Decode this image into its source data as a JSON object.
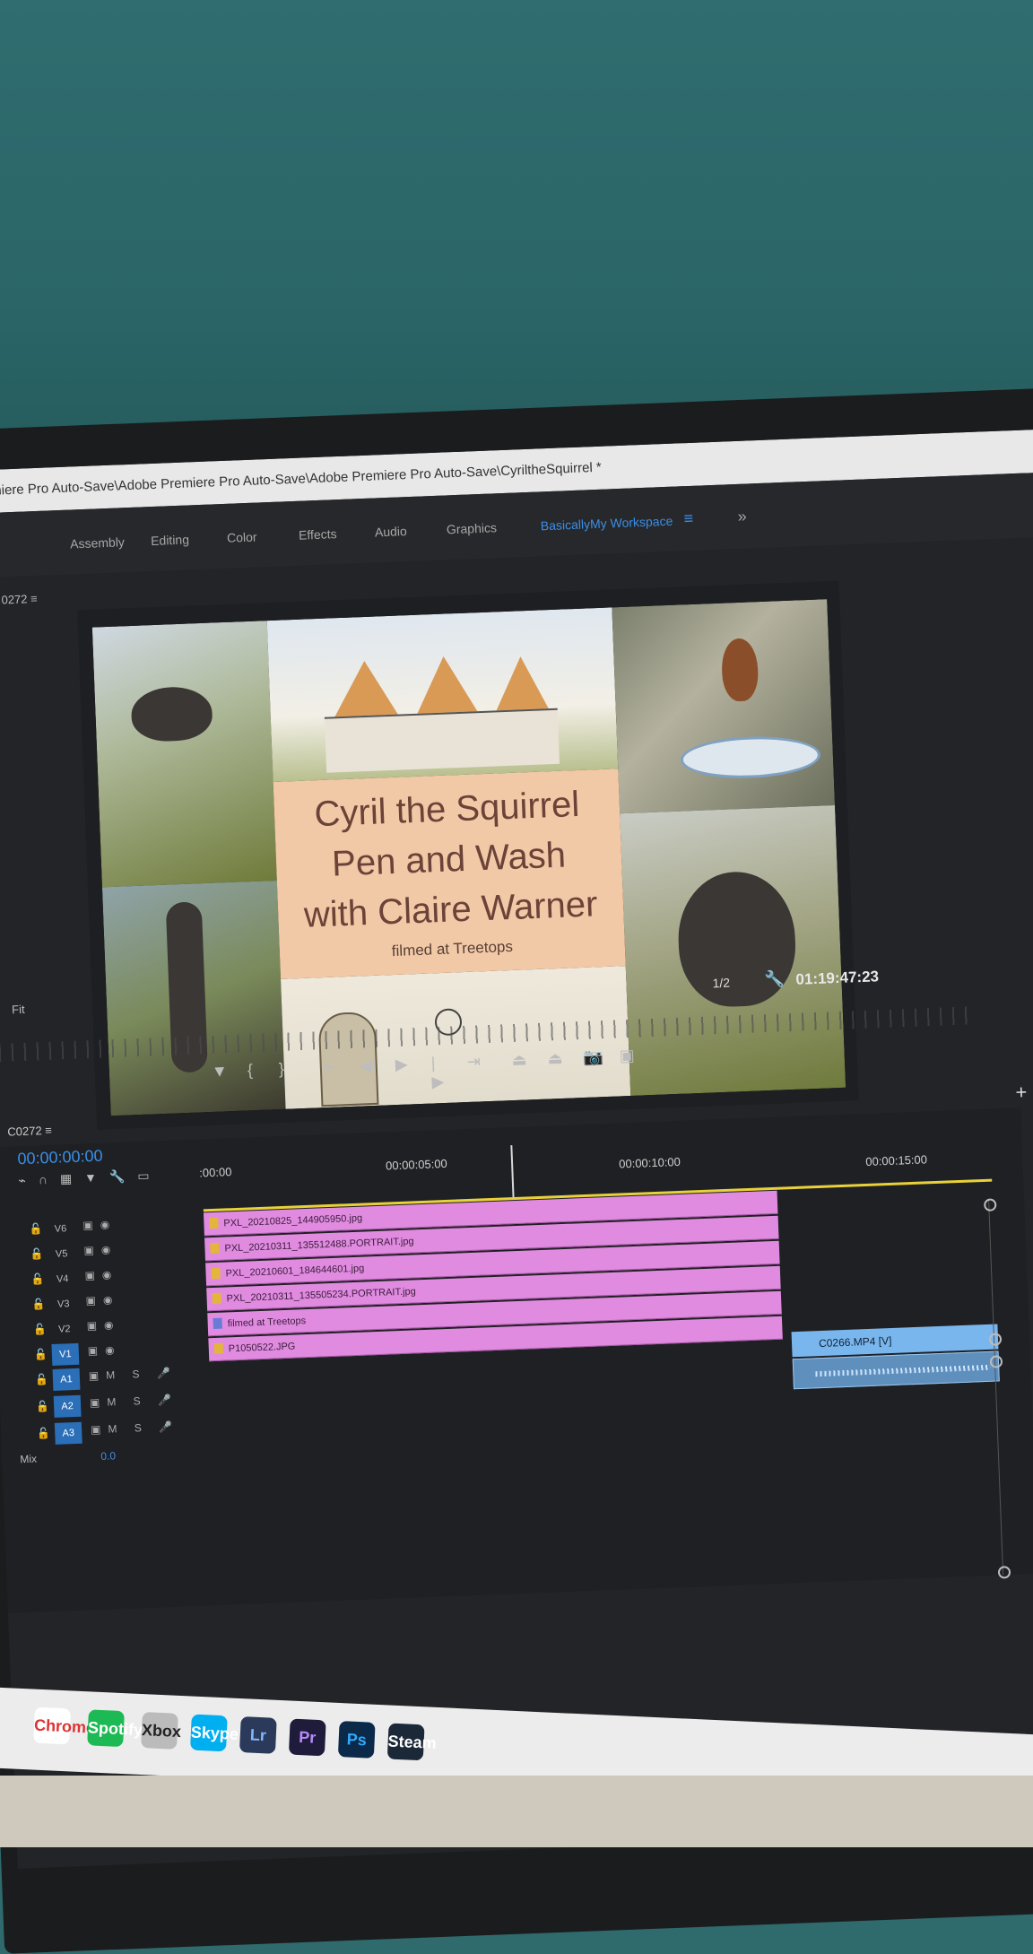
{
  "window": {
    "title": "emiere Pro Auto-Save\\Adobe Premiere Pro Auto-Save\\Adobe Premiere Pro Auto-Save\\CyriltheSquirrel *"
  },
  "workspaces": {
    "tabs": [
      "Assembly",
      "Editing",
      "Color",
      "Effects",
      "Audio",
      "Graphics"
    ],
    "active": "BasicallyMy Workspace",
    "menu_glyph": "≡",
    "more_glyph": "»"
  },
  "program_monitor": {
    "panel_label": "0272 ≡",
    "title_card": {
      "line1": "Cyril the Squirrel",
      "line2": "Pen and Wash",
      "line3": "with Claire Warner",
      "subtitle": "filmed at Treetops"
    },
    "zoom": "Fit",
    "resolution": "1/2",
    "timecode": "01:19:47:23"
  },
  "timeline": {
    "sequence_name": "C0272 ≡",
    "current_time": "00:00:00:00",
    "ruler_ticks": [
      ":00:00",
      "00:00:05:00",
      "00:00:10:00",
      "00:00:15:00"
    ],
    "video_tracks": [
      "V6",
      "V5",
      "V4",
      "V3",
      "V2",
      "V1"
    ],
    "audio_tracks": [
      "A1",
      "A2",
      "A3"
    ],
    "clips": [
      "PXL_20210825_144905950.jpg",
      "PXL_20210311_135512488.PORTRAIT.jpg",
      "PXL_20210601_184644601.jpg",
      "PXL_20210311_135505234.PORTRAIT.jpg",
      "filmed at Treetops",
      "P1050522.JPG"
    ],
    "video_clip_right": "C0266.MP4 [V]",
    "mix_label": "Mix",
    "mix_value": "0.0",
    "track_button_labels": [
      "M",
      "S"
    ]
  },
  "taskbar": {
    "apps": [
      "Chrome",
      "Spotify",
      "Xbox",
      "Skype",
      "Lr",
      "Pr",
      "Ps",
      "Steam"
    ]
  },
  "colors": {
    "accent_blue": "#3a8ee6",
    "clip_pink": "#e08be0",
    "clip_blue": "#7ab6ee",
    "wall_teal": "#2f6a6c"
  }
}
